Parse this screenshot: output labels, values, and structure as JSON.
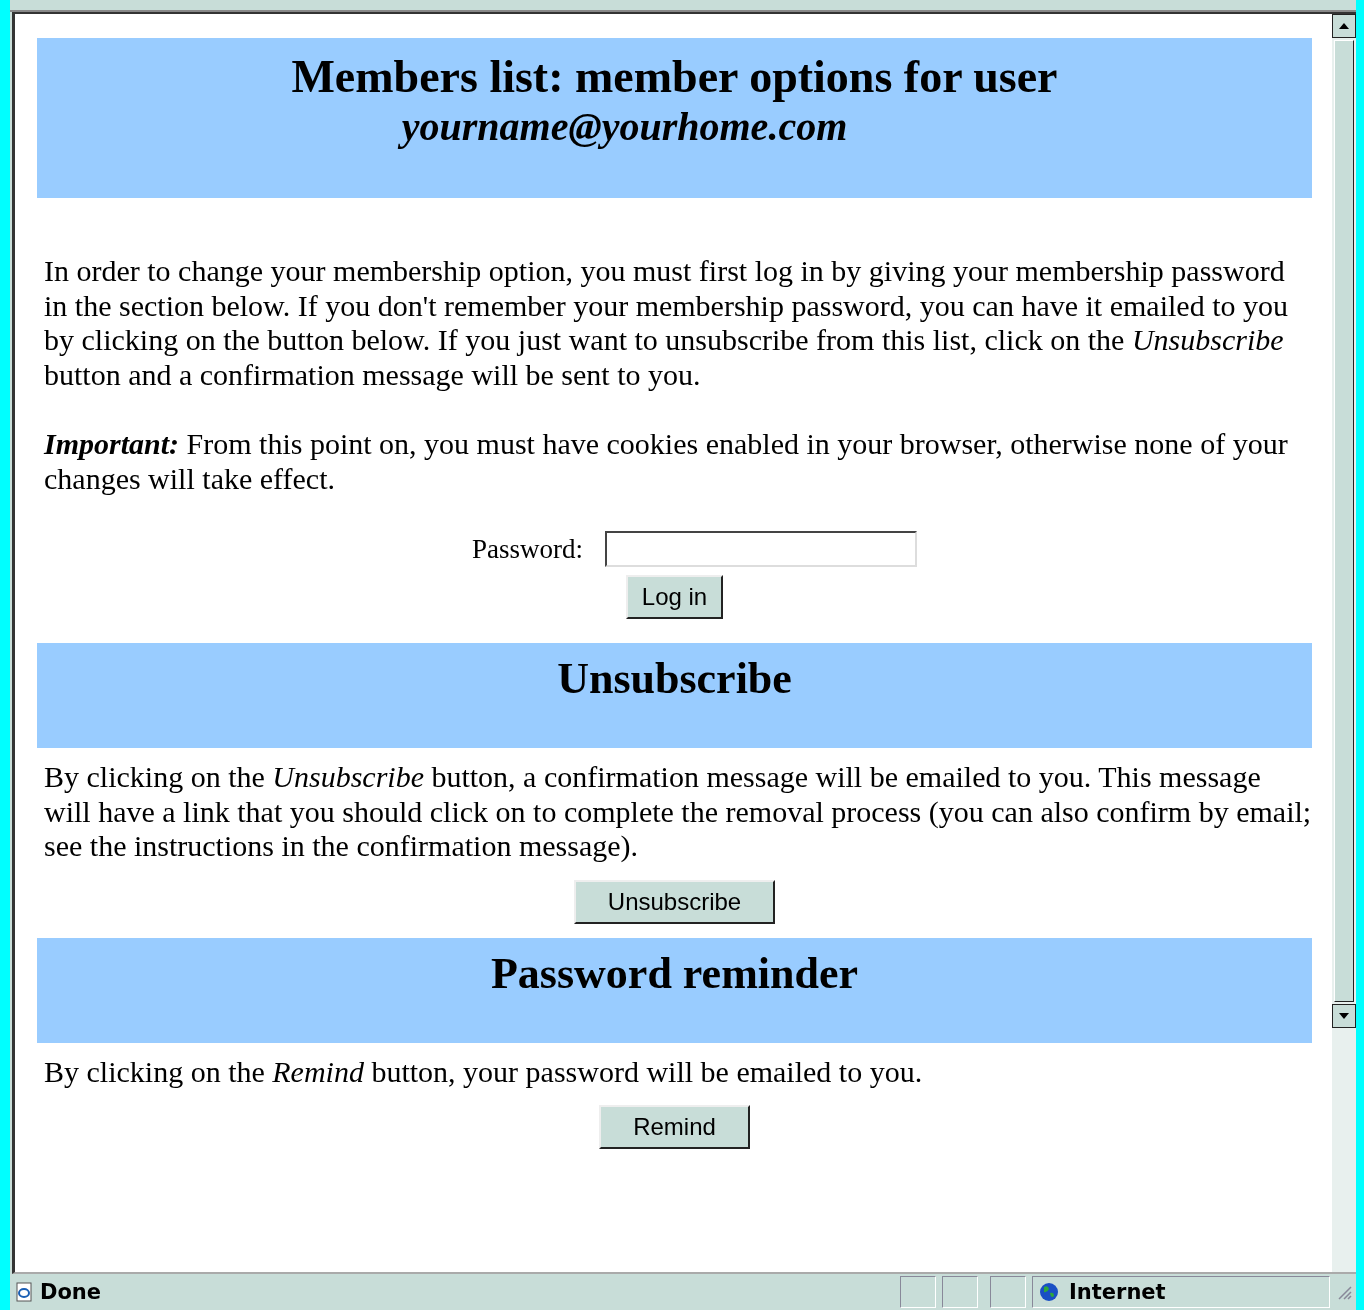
{
  "header": {
    "title": "Members list: member options for user",
    "user": "yourname@yourhome.com"
  },
  "intro": [
    "In order to change your membership option, you must first log in by giving your membership password in the section below. If you don't remember your membership password, you can have it emailed to you by clicking on the button below. If you just want to unsubscribe from this list, click on the *Unsubscribe* button and a confirmation message will be sent to you.",
    "**Important:** From this point on, you must have cookies enabled in your browser, otherwise none of your changes will take effect."
  ],
  "login": {
    "label": "Password:",
    "button": "Log in"
  },
  "sections": [
    {
      "heading": "Unsubscribe",
      "text": "By clicking on the *Unsubscribe* button, a confirmation message will be emailed to you. This message will have a link that you should click on to complete the removal process (you can also confirm by email; see the instructions in the confirmation message).",
      "button": "Unsubscribe"
    },
    {
      "heading": "Password reminder",
      "text": "By clicking on the *Remind* button, your password will be emailed to you.",
      "button": "Remind"
    }
  ],
  "status_bar": {
    "status": "Done",
    "zone": "Internet"
  }
}
